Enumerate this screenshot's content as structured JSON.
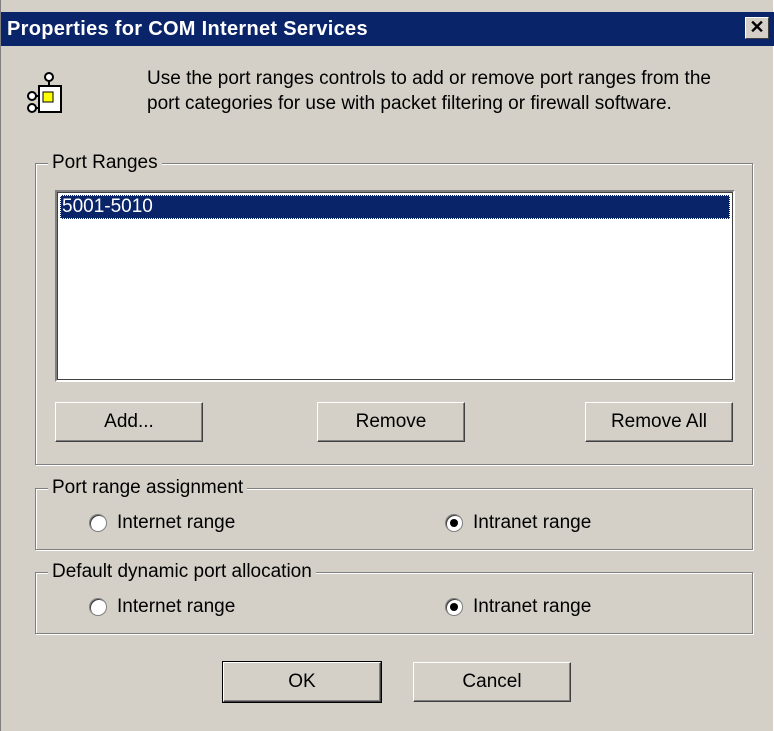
{
  "window": {
    "title": "Properties for COM Internet Services",
    "close_glyph": "✕"
  },
  "description": "Use the port ranges controls to add or remove port ranges from the port categories for use with packet filtering or firewall software.",
  "port_ranges": {
    "label": "Port Ranges",
    "items": [
      "5001-5010"
    ],
    "selected_index": 0,
    "buttons": {
      "add": "Add...",
      "remove": "Remove",
      "remove_all": "Remove All"
    }
  },
  "port_range_assignment": {
    "label": "Port range assignment",
    "options": [
      {
        "label": "Internet range",
        "checked": false
      },
      {
        "label": "Intranet range",
        "checked": true
      }
    ]
  },
  "default_dynamic": {
    "label": "Default dynamic port allocation",
    "options": [
      {
        "label": "Internet range",
        "checked": false
      },
      {
        "label": "Intranet range",
        "checked": true
      }
    ]
  },
  "footer": {
    "ok": "OK",
    "cancel": "Cancel"
  },
  "colors": {
    "titlebar": "#0a246a",
    "face": "#d4d0c8",
    "selection": "#0a246a"
  },
  "icons": [
    "properties-network-icon",
    "close-icon",
    "radio-icon"
  ]
}
